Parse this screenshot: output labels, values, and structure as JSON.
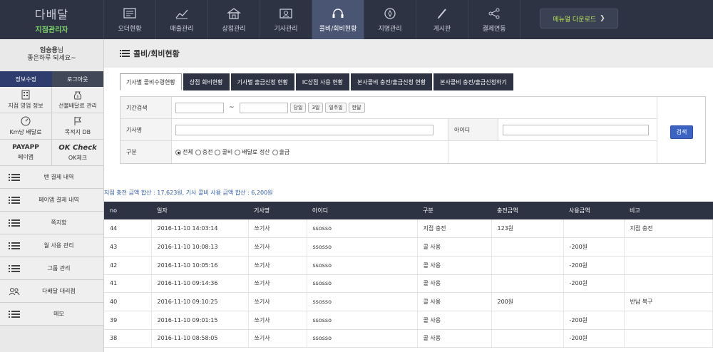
{
  "logo": {
    "main": "다배달",
    "sub": "지점관리자"
  },
  "nav": [
    {
      "label": "오더현황",
      "icon": "order-icon"
    },
    {
      "label": "매출관리",
      "icon": "chart-icon"
    },
    {
      "label": "상점관리",
      "icon": "store-icon"
    },
    {
      "label": "기사관리",
      "icon": "id-card-icon"
    },
    {
      "label": "콜비/회비현황",
      "icon": "headset-icon",
      "active": true
    },
    {
      "label": "지명관리",
      "icon": "compass-icon"
    },
    {
      "label": "게시판",
      "icon": "pen-icon"
    },
    {
      "label": "결제연동",
      "icon": "share-icon"
    }
  ],
  "manual_download": "메뉴얼 다운로드",
  "user": {
    "name": "임승용",
    "suffix": "님",
    "greeting": "좋은하루 되세요~"
  },
  "sidebar_buttons": {
    "edit": "정보수정",
    "logout": "로그아웃"
  },
  "sidebar_grid": [
    {
      "label": "지점 영업 정보",
      "icon": "building-icon"
    },
    {
      "label": "선불배달료 관리",
      "icon": "money-bag-icon"
    },
    {
      "label": "Km당 배달료",
      "icon": "speedometer-icon"
    },
    {
      "label": "목적지 DB",
      "icon": "flag-icon"
    },
    {
      "label": "페이앱",
      "logo": "PAYAPP"
    },
    {
      "label": "OK체크",
      "logo": "OK Check"
    }
  ],
  "sidebar_list": [
    "밴 결제 내역",
    "페이앱 결제 내역",
    "쪽지함",
    "월 사용 관리",
    "그룹 관리",
    "다배달 대리점",
    "메모"
  ],
  "page_title": "콜비/회비현황",
  "tabs": [
    {
      "label": "기사별 콜비수령현황",
      "active": true
    },
    {
      "label": "상점 회비현황"
    },
    {
      "label": "기사별 출금신청 현황"
    },
    {
      "label": "IC상점 사용 현황"
    },
    {
      "label": "본사콜비 충전/출금신청 현황"
    },
    {
      "label": "본사콜비 충전/출금신청하기"
    }
  ],
  "search": {
    "period_label": "기간검색",
    "tilde": "~",
    "quick": [
      "당일",
      "3일",
      "일주일",
      "한달"
    ],
    "driver_label": "기사명",
    "id_label": "아이디",
    "type_label": "구분",
    "types": [
      {
        "label": "전체",
        "checked": true
      },
      {
        "label": "충전"
      },
      {
        "label": "콜비"
      },
      {
        "label": "배달료 정산"
      },
      {
        "label": "출금"
      }
    ],
    "button": "검색"
  },
  "summary": "지점 충전 금액 합산 : 17,623원, 기사 콜비 사용 금액 합산 : 6,200원",
  "table": {
    "headers": [
      "no",
      "일자",
      "기사명",
      "아이디",
      "구분",
      "충전금액",
      "사용금액",
      "비고"
    ],
    "rows": [
      [
        "44",
        "2016-11-10 14:03:14",
        "쏘기사",
        "ssosso",
        "지점 충전",
        "123원",
        "",
        "지점 충전"
      ],
      [
        "43",
        "2016-11-10 10:08:13",
        "쏘기사",
        "ssosso",
        "콜 사용",
        "",
        "-200원",
        ""
      ],
      [
        "42",
        "2016-11-10 10:05:16",
        "쏘기사",
        "ssosso",
        "콜 사용",
        "",
        "-200원",
        ""
      ],
      [
        "41",
        "2016-11-10 09:14:36",
        "쏘기사",
        "ssosso",
        "콜 사용",
        "",
        "-200원",
        ""
      ],
      [
        "40",
        "2016-11-10 09:10:25",
        "쏘기사",
        "ssosso",
        "콜 사용",
        "200원",
        "",
        "반납 복구"
      ],
      [
        "39",
        "2016-11-10 09:01:15",
        "쏘기사",
        "ssosso",
        "콜 사용",
        "",
        "-200원",
        ""
      ],
      [
        "38",
        "2016-11-10 08:58:05",
        "쏘기사",
        "ssosso",
        "콜 사용",
        "",
        "-200원",
        ""
      ]
    ]
  }
}
